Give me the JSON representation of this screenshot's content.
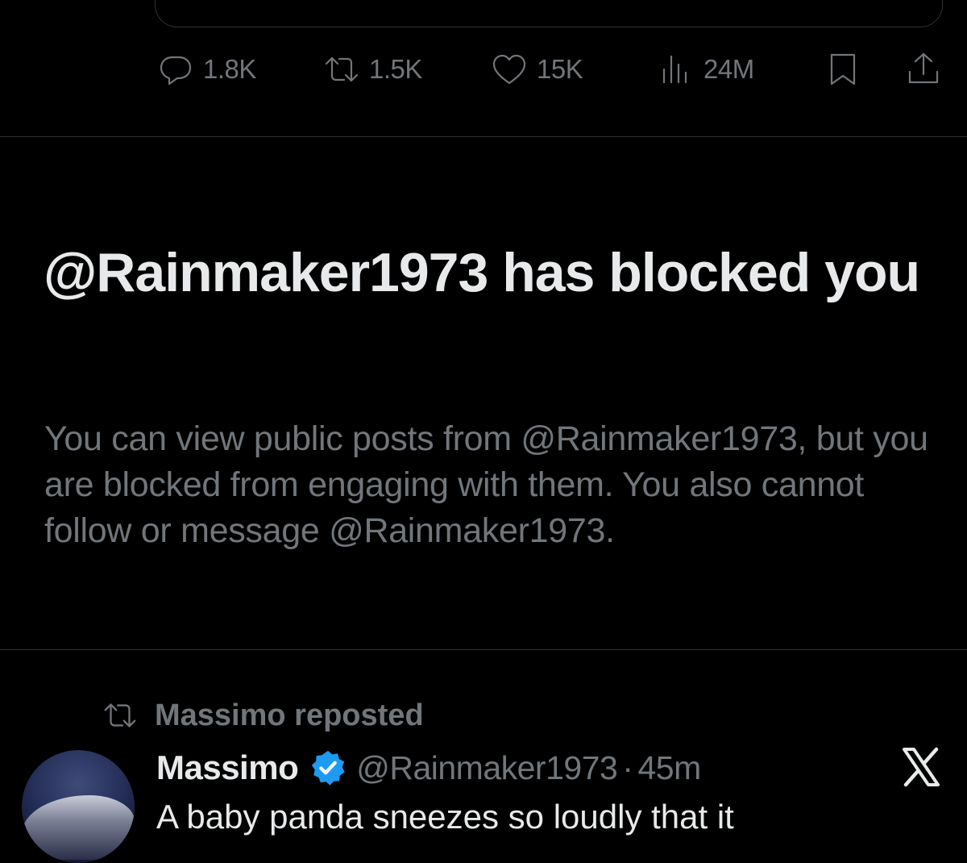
{
  "quoted_post": {},
  "actions": {
    "replies": {
      "icon": "reply-icon",
      "count": "1.8K"
    },
    "reposts": {
      "icon": "repost-icon",
      "count": "1.5K"
    },
    "likes": {
      "icon": "heart-icon",
      "count": "15K"
    },
    "views": {
      "icon": "views-chart-icon",
      "count": "24M"
    },
    "bookmark": {
      "icon": "bookmark-icon"
    },
    "share": {
      "icon": "share-icon"
    }
  },
  "blocked_notice": {
    "title": "@Rainmaker1973 has blocked you",
    "body": "You can view public posts from @Rainmaker1973, but you are blocked from engaging with them. You also cannot follow or message @Rainmaker1973."
  },
  "next_post": {
    "repost_label": "Massimo reposted",
    "display_name": "Massimo",
    "verified_icon": "verified-badge-icon",
    "handle": "@Rainmaker1973",
    "separator": "·",
    "time": "45m",
    "text": "A baby panda sneezes so loudly that it",
    "brand_icon": "x-logo-icon"
  },
  "colors": {
    "background": "#000000",
    "primary_text": "#e7e9ea",
    "secondary_text": "#71767b",
    "divider": "#2f3336",
    "verified_blue": "#1d9bf0"
  }
}
